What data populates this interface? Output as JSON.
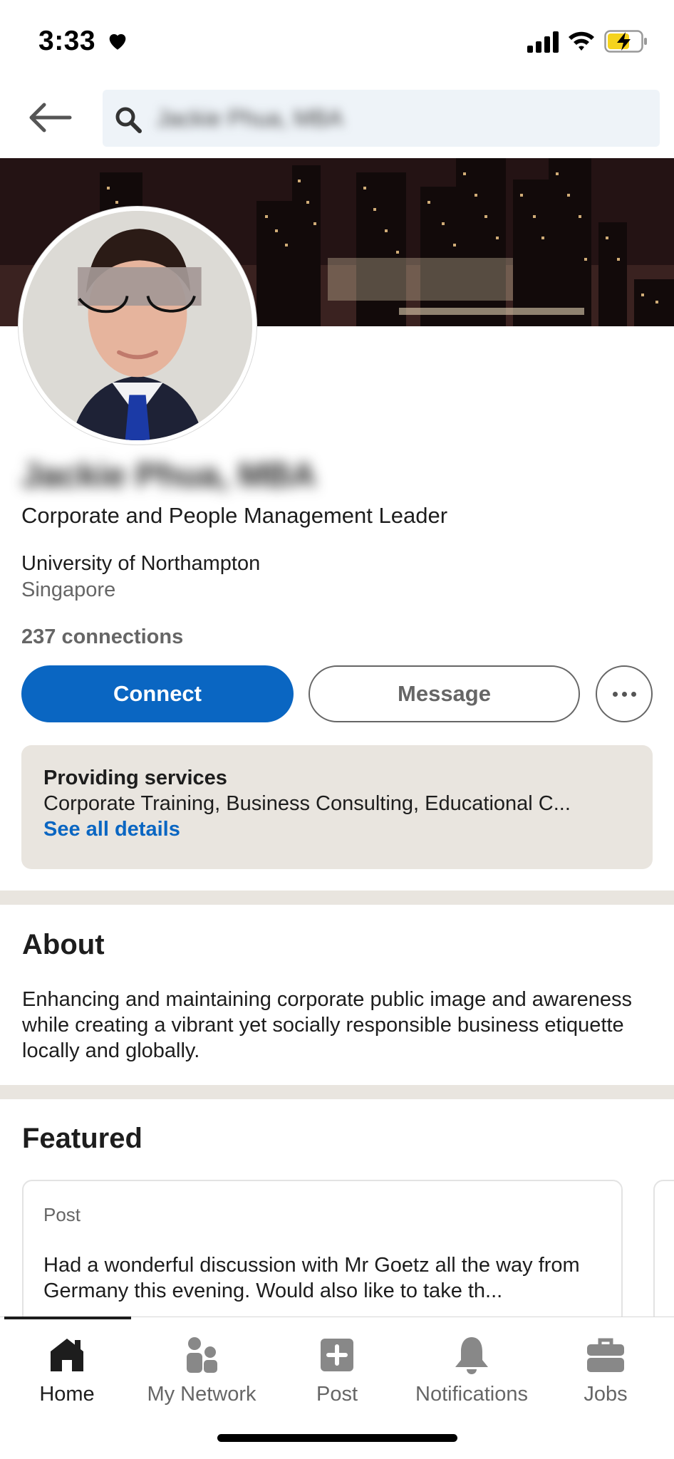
{
  "status_bar": {
    "time": "3:33"
  },
  "search": {
    "query": "Jackie Phua, MBA"
  },
  "profile": {
    "name": "Jackie Phua, MBA",
    "headline": "Corporate and People Management Leader",
    "school": "University of Northampton",
    "location": "Singapore",
    "connections": "237 connections"
  },
  "actions": {
    "connect_label": "Connect",
    "message_label": "Message"
  },
  "services": {
    "title": "Providing services",
    "list": "Corporate Training, Business Consulting, Educational C...",
    "link": "See all details"
  },
  "about": {
    "title": "About",
    "text": "Enhancing and maintaining corporate public image and awareness while creating a vibrant yet socially responsible business etiquette locally and globally."
  },
  "featured": {
    "title": "Featured",
    "card": {
      "type": "Post",
      "text": "Had a wonderful discussion with Mr Goetz all the way from Germany this evening. Would also like to take th..."
    }
  },
  "bottom_nav": {
    "items": [
      {
        "label": "Home",
        "icon": "home-icon",
        "active": true
      },
      {
        "label": "My Network",
        "icon": "network-icon",
        "active": false
      },
      {
        "label": "Post",
        "icon": "post-icon",
        "active": false
      },
      {
        "label": "Notifications",
        "icon": "bell-icon",
        "active": false
      },
      {
        "label": "Jobs",
        "icon": "briefcase-icon",
        "active": false
      }
    ]
  },
  "colors": {
    "brand_blue": "#0a66c2",
    "section_divider": "#e9e5df",
    "battery_charging": "#f5d31d"
  }
}
